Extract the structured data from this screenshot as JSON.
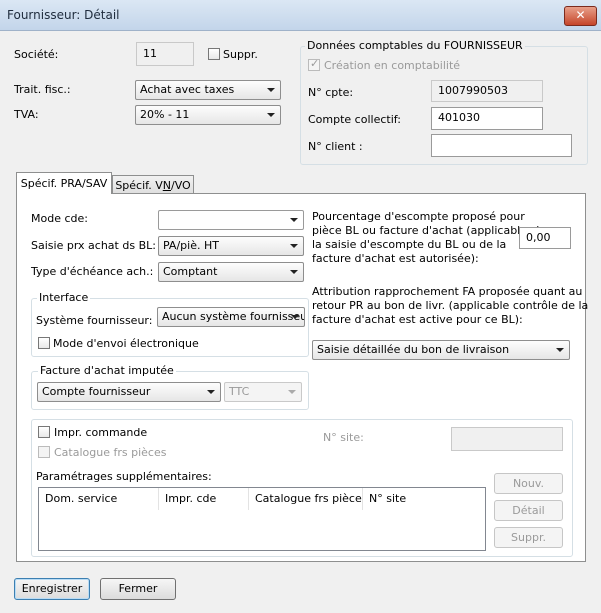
{
  "window": {
    "title": "Fournisseur: Détail",
    "close_glyph": "✕"
  },
  "societe": {
    "label": "Société:",
    "value": "11",
    "suppr_label": "Suppr."
  },
  "trait_fisc": {
    "label": "Trait. fisc.:",
    "value": "Achat avec taxes"
  },
  "tva": {
    "label": "TVA:",
    "value": "20% - 11"
  },
  "comptable": {
    "title": "Données comptables du FOURNISSEUR",
    "creation_label": "Création en comptabilité",
    "ncpte_label": "N° cpte:",
    "ncpte_value": "1007990503",
    "collectif_label": "Compte collectif:",
    "collectif_value": "401030",
    "nclient_label": "N° client :",
    "nclient_value": ""
  },
  "tabs": {
    "tab1": "Spécif. PRA/SAV",
    "tab2_pre": "Spécif. V",
    "tab2_u": "N",
    "tab2_post": "/VO"
  },
  "pra": {
    "mode_cde_label": "Mode cde:",
    "mode_cde_value": "",
    "saisie_label": "Saisie prx achat ds BL:",
    "saisie_value": "PA/piè. HT",
    "echeance_label": "Type d'échéance ach.:",
    "echeance_value": "Comptant",
    "interface_title": "Interface",
    "systeme_label": "Système fournisseur:",
    "systeme_value": "Aucun système fournisseur",
    "envoi_label": "Mode d'envoi électronique",
    "facture_title": "Facture d'achat imputée",
    "facture_value": "Compte fournisseur",
    "ttc_value": "TTC",
    "escompte_text": [
      "Pourcentage d'escompte proposé pour",
      "pièce BL ou facture d'achat (applicable si",
      "la saisie d'escompte du BL ou de la",
      "facture d'achat est autorisée):"
    ],
    "escompte_value": "0,00",
    "attribution_text": [
      "Attribution rapprochement FA proposée quant au",
      "retour PR au bon de livr. (applicable contrôle de la",
      "facture d'achat est active pour ce BL):"
    ],
    "attribution_value": "Saisie détaillée du bon de livraison",
    "impr_label": "Impr. commande",
    "catalogue_label": "Catalogue frs pièces",
    "nsite_label": "N° site:",
    "nsite_value": "",
    "param_title": "Paramétrages supplémentaires:",
    "columns": [
      "Dom. service",
      "Impr. cde",
      "Catalogue frs pièces",
      "N° site"
    ],
    "nouv": "Nouv.",
    "detail": "Détail",
    "suppr": "Suppr."
  },
  "footer": {
    "enregistrer": "Enregistrer",
    "fermer": "Fermer"
  },
  "colors": {
    "titlebar": "#c3d5ea",
    "close": "#c5452a",
    "dialog_bg": "#f0f0f0"
  }
}
